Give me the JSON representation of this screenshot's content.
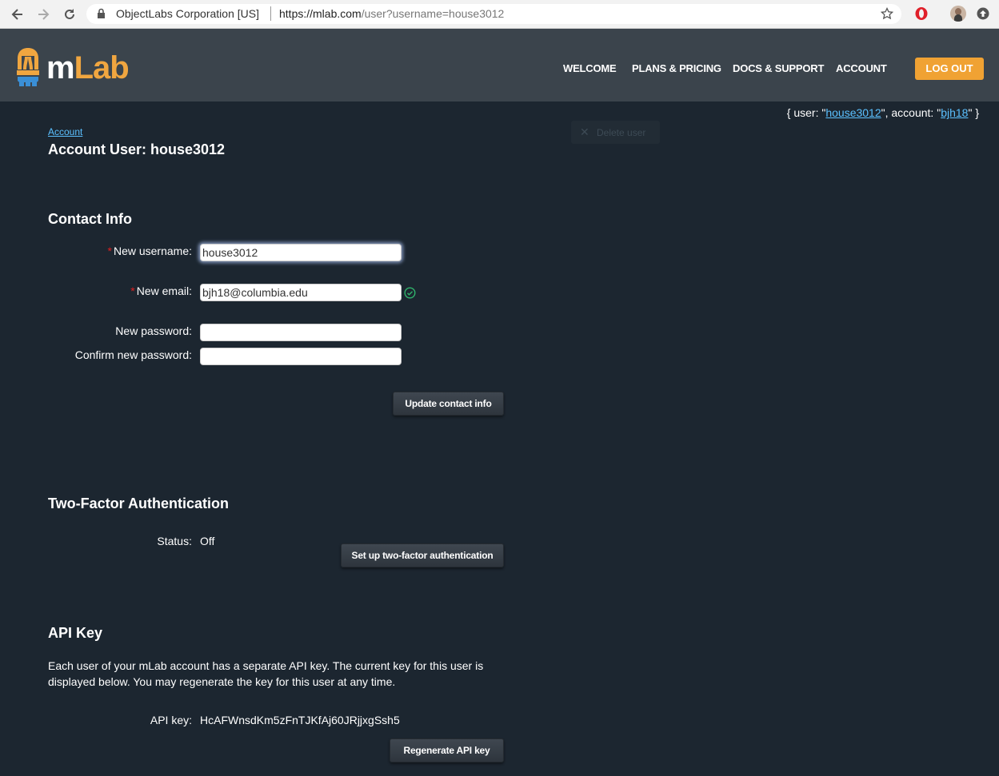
{
  "browser": {
    "site_name": "ObjectLabs Corporation [US]",
    "url_host": "https://mlab.com",
    "url_path": "/user?username=house3012"
  },
  "header": {
    "logo_m": "m",
    "logo_lab": "Lab",
    "nav": [
      "WELCOME",
      "PLANS & PRICING",
      "DOCS & SUPPORT",
      "ACCOUNT"
    ],
    "logout": "LOG OUT",
    "brand_color": "#f0a640"
  },
  "context": {
    "prefix": "{ user: \"",
    "user": "house3012",
    "middle": "\", account: \"",
    "account": "bjh18",
    "suffix": "\" }"
  },
  "breadcrumb": "Account",
  "page_title": "Account User: house3012",
  "delete_user": "Delete user",
  "contact": {
    "title": "Contact Info",
    "username_label": "New username:",
    "username_value": "house3012",
    "email_label": "New email:",
    "email_value": "bjh18@columbia.edu",
    "password_label": "New password:",
    "confirm_label": "Confirm new password:",
    "update_button": "Update contact info"
  },
  "two_factor": {
    "title": "Two-Factor Authentication",
    "status_label": "Status:",
    "status_value": "Off",
    "setup_button": "Set up two-factor authentication"
  },
  "api": {
    "title": "API Key",
    "description": "Each user of your mLab account has a separate API key. The current key for this user is displayed below. You may regenerate the key for this user at any time.",
    "key_label": "API key:",
    "key_value": "HcAFWnsdKm5zFnTJKfAj60JRjjxgSsh5",
    "regenerate_button": "Regenerate API key"
  }
}
